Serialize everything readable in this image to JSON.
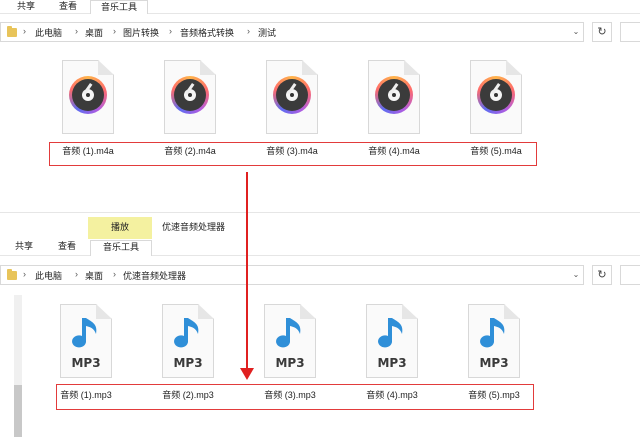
{
  "top_window": {
    "ribbon_tabs": [
      {
        "label": "共享"
      },
      {
        "label": "查看"
      },
      {
        "label": "音乐工具"
      }
    ],
    "breadcrumb": [
      "此电脑",
      "桌面",
      "图片转换",
      "音频格式转换",
      "测试"
    ],
    "files": [
      {
        "name": "音频 (1).m4a",
        "icon": "m4a-disc-icon"
      },
      {
        "name": "音频 (2).m4a",
        "icon": "m4a-disc-icon"
      },
      {
        "name": "音频 (3).m4a",
        "icon": "m4a-disc-icon"
      },
      {
        "name": "音频 (4).m4a",
        "icon": "m4a-disc-icon"
      },
      {
        "name": "音频 (5).m4a",
        "icon": "m4a-disc-icon"
      }
    ]
  },
  "bottom_window": {
    "context_tab": "播放",
    "window_title": "优速音频处理器",
    "ribbon_tabs": [
      {
        "label": "共享"
      },
      {
        "label": "查看"
      },
      {
        "label": "音乐工具"
      }
    ],
    "breadcrumb": [
      "此电脑",
      "桌面",
      "优速音频处理器"
    ],
    "mp3_label": "MP3",
    "files": [
      {
        "name": "音频 (1).mp3",
        "icon": "mp3-note-icon"
      },
      {
        "name": "音频 (2).mp3",
        "icon": "mp3-note-icon"
      },
      {
        "name": "音频 (3).mp3",
        "icon": "mp3-note-icon"
      },
      {
        "name": "音频 (4).mp3",
        "icon": "mp3-note-icon"
      },
      {
        "name": "音频 (5).mp3",
        "icon": "mp3-note-icon"
      }
    ]
  },
  "colors": {
    "highlight_box": "#e23b3b",
    "arrow": "#e02020",
    "context_tab_bg": "#f4f1a0",
    "mp3_note": "#2f8fd8"
  }
}
